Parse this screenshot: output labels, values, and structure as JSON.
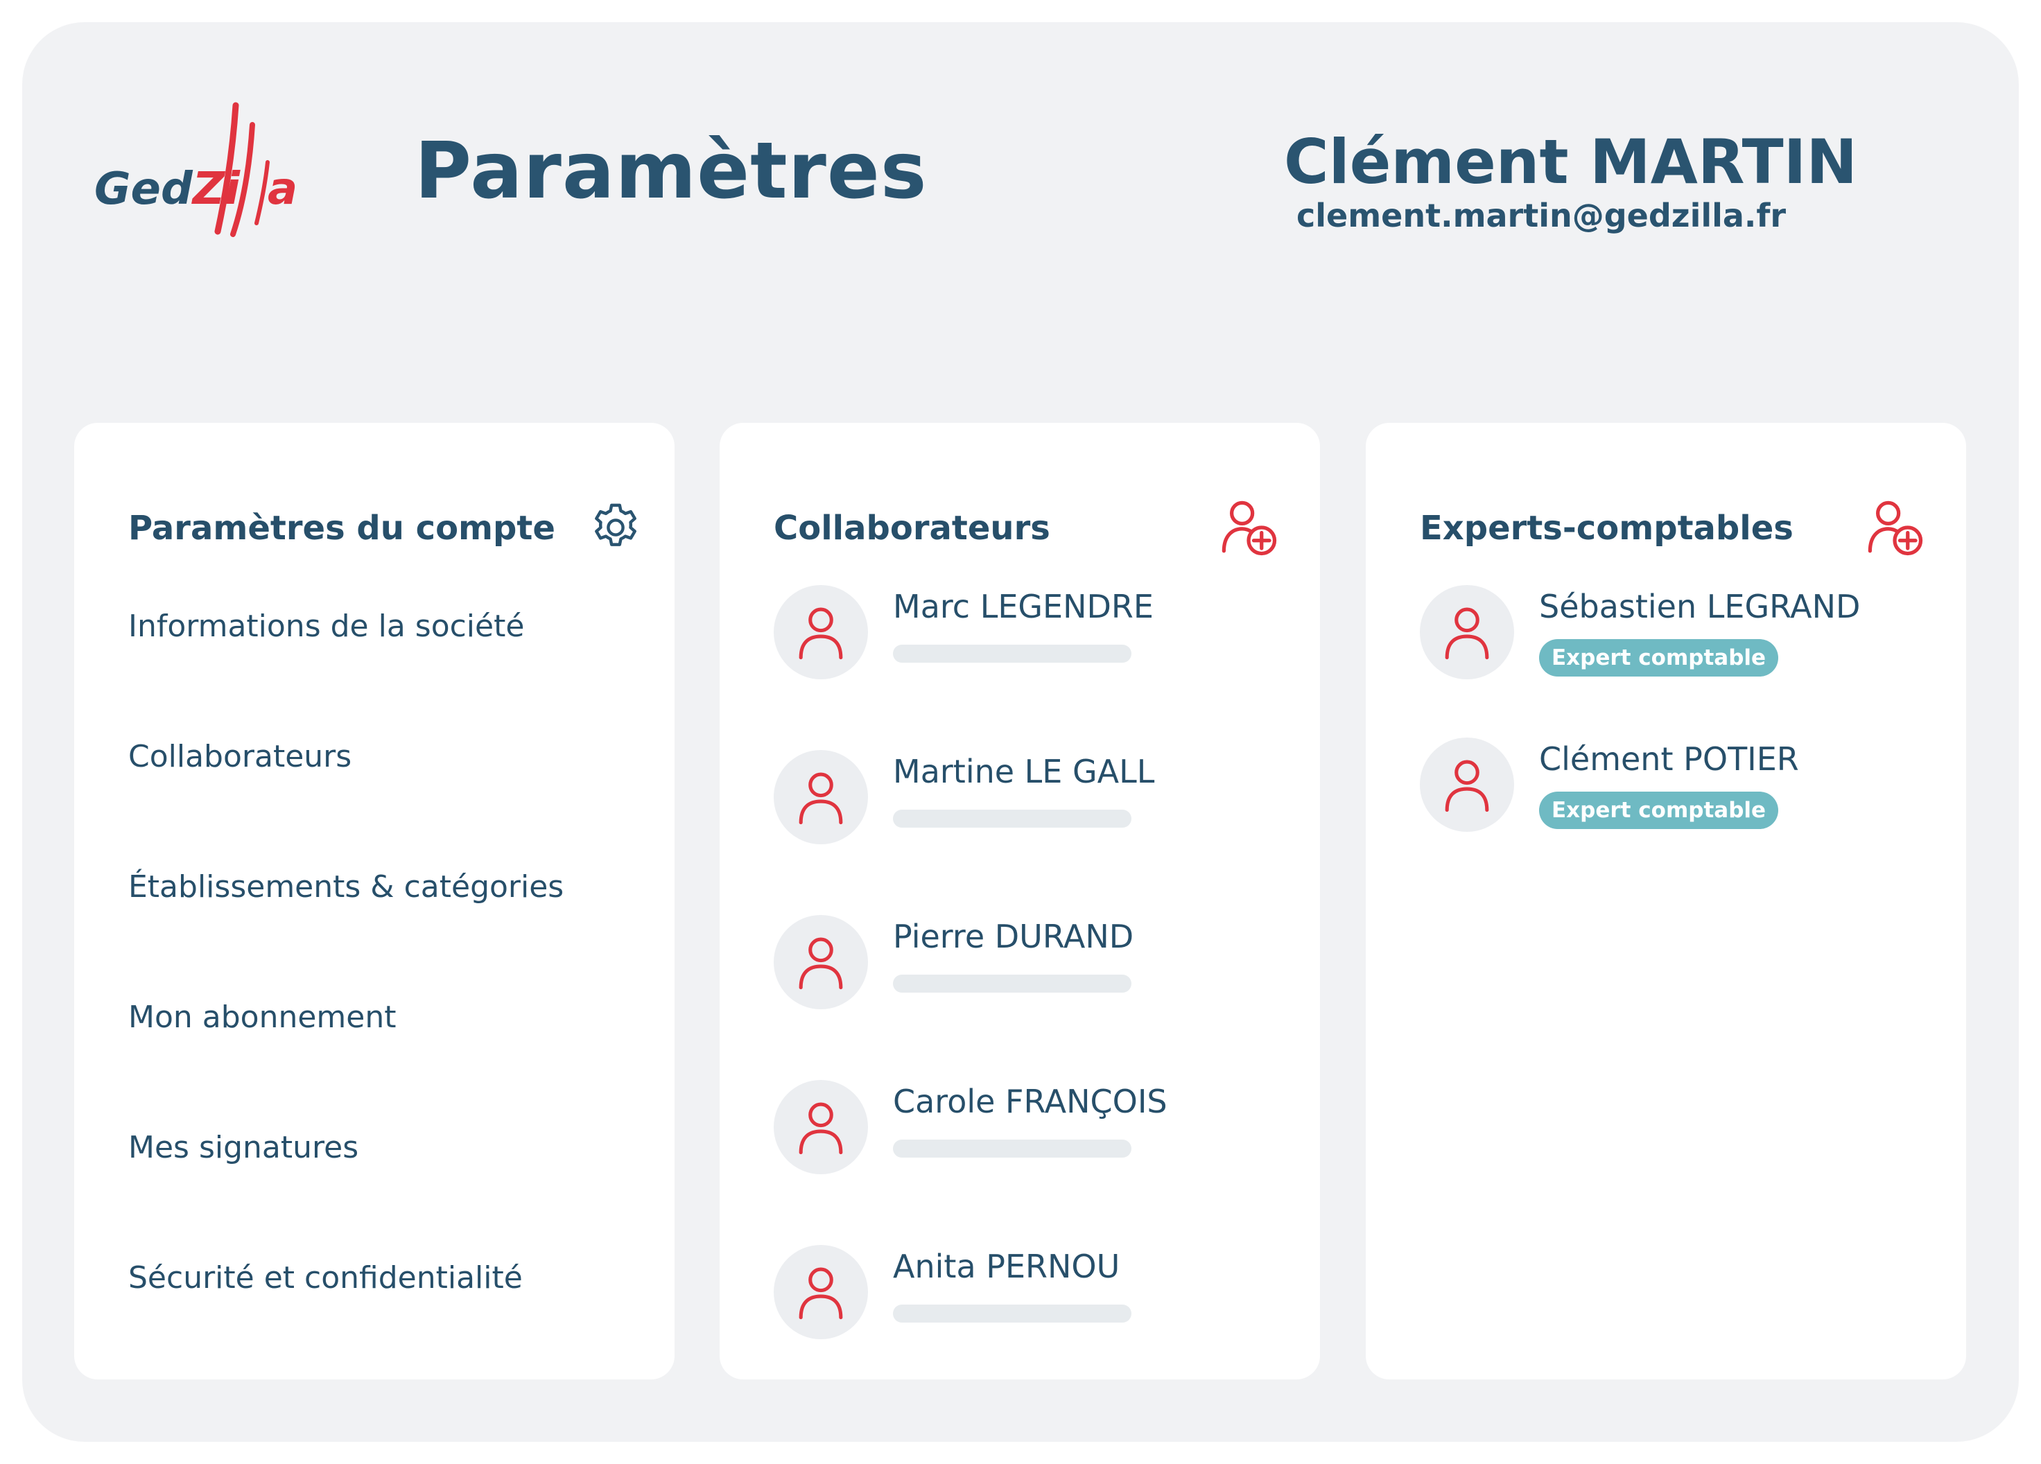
{
  "app": {
    "logo_text_main": "GedZi",
    "logo_text_end": "a",
    "brand_colors": {
      "navy": "#2a5470",
      "red": "#e0343f",
      "teal": "#6fbac3"
    }
  },
  "header": {
    "title": "Paramètres",
    "user_name": "Clément MARTIN",
    "user_email": "clement.martin@gedzilla.fr"
  },
  "account_settings": {
    "title": "Paramètres du compte",
    "icon": "gear-icon",
    "items": [
      {
        "label": "Informations de la société"
      },
      {
        "label": "Collaborateurs"
      },
      {
        "label": "Établissements & catégories"
      },
      {
        "label": "Mon abonnement"
      },
      {
        "label": "Mes signatures"
      },
      {
        "label": "Sécurité et confidentialité"
      }
    ]
  },
  "collaborators": {
    "title": "Collaborateurs",
    "icon": "add-user-icon",
    "people": [
      {
        "name": "Marc LEGENDRE"
      },
      {
        "name": "Martine LE GALL"
      },
      {
        "name": "Pierre DURAND"
      },
      {
        "name": "Carole FRANÇOIS"
      },
      {
        "name": "Anita PERNOU"
      }
    ]
  },
  "accountants": {
    "title": "Experts-comptables",
    "icon": "add-user-icon",
    "people": [
      {
        "name": "Sébastien LEGRAND",
        "role": "Expert comptable"
      },
      {
        "name": "Clément POTIER",
        "role": "Expert comptable"
      }
    ]
  }
}
